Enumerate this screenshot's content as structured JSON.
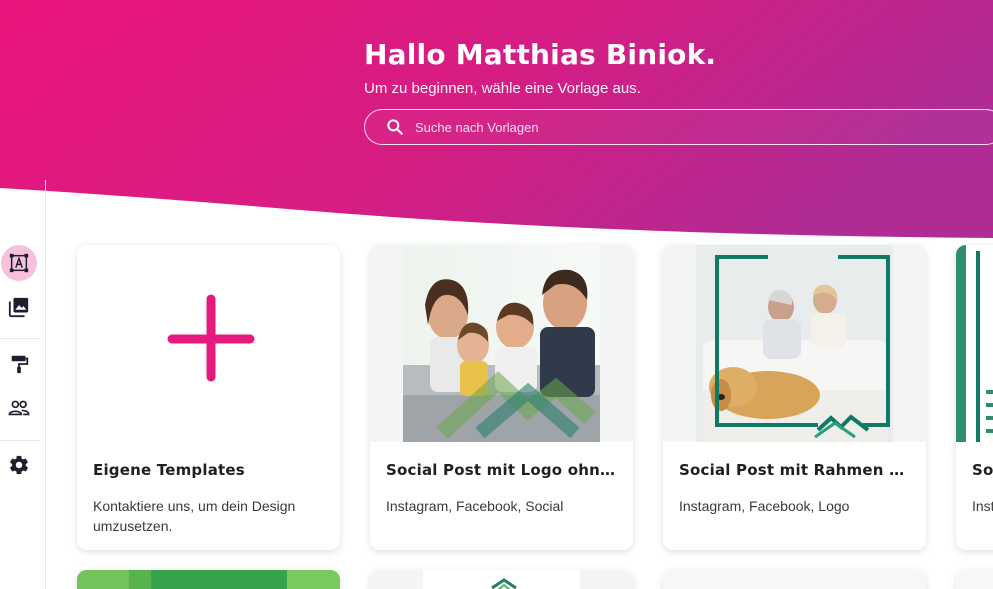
{
  "header": {
    "greeting": "Hallo Matthias Biniok.",
    "subline": "Um zu beginnen, wähle eine Vorlage aus.",
    "search_placeholder": "Suche nach Vorlagen"
  },
  "sidebar": {
    "items": [
      {
        "icon": "text-frame-icon",
        "active": true
      },
      {
        "icon": "image-library-icon",
        "active": false
      },
      {
        "icon": "paint-roller-icon",
        "active": false
      },
      {
        "icon": "people-icon",
        "active": false
      },
      {
        "icon": "gear-icon",
        "active": false
      }
    ]
  },
  "templates": [
    {
      "title": "Eigene Templates",
      "description": "Kontaktiere uns, um dein Design umzusetzen."
    },
    {
      "title": "Social Post mit Logo ohne Text",
      "description": "Instagram, Facebook, Social"
    },
    {
      "title": "Social Post mit Rahmen und Logo",
      "description": "Instagram, Facebook, Logo"
    },
    {
      "title": "Social Post",
      "description": "Instagram"
    }
  ],
  "colors": {
    "accent": "#e5197e",
    "gradient_start": "#e8137a",
    "gradient_end": "#b52a92",
    "frame_green": "#1a7f66"
  }
}
